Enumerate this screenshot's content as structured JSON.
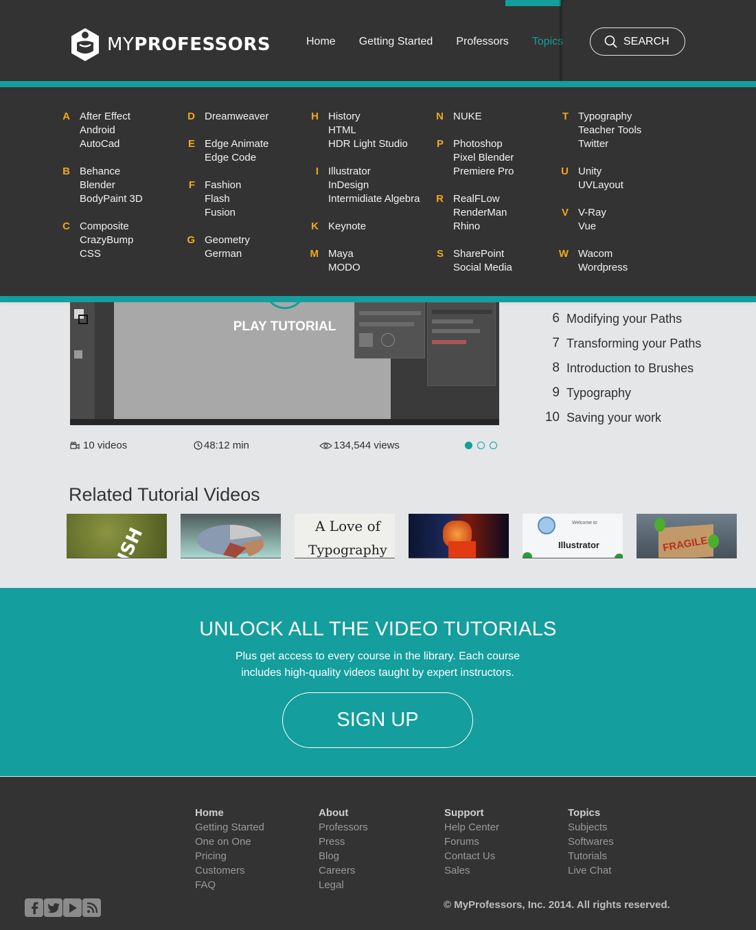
{
  "header": {
    "brand": {
      "prefix": "MY",
      "name": "PROFESSORS"
    },
    "nav": [
      {
        "label": "Home",
        "active": false
      },
      {
        "label": "Getting Started",
        "active": false
      },
      {
        "label": "Professors",
        "active": false
      },
      {
        "label": "Topics",
        "active": true
      }
    ],
    "search_label": "SEARCH"
  },
  "topics_menu": {
    "columns": [
      [
        {
          "letter": "A",
          "items": [
            "After Effect",
            "Android",
            "AutoCad"
          ]
        },
        {
          "letter": "B",
          "items": [
            "Behance",
            "Blender",
            "BodyPaint 3D"
          ]
        },
        {
          "letter": "C",
          "items": [
            "Composite",
            "CrazyBump",
            "CSS"
          ]
        }
      ],
      [
        {
          "letter": "D",
          "items": [
            "Dreamweaver"
          ]
        },
        {
          "letter": "E",
          "items": [
            "Edge Animate",
            "Edge Code"
          ]
        },
        {
          "letter": "F",
          "items": [
            "Fashion",
            "Flash",
            "Fusion"
          ]
        },
        {
          "letter": "G",
          "items": [
            "Geometry",
            "German"
          ]
        }
      ],
      [
        {
          "letter": "H",
          "items": [
            "History",
            "HTML",
            "HDR Light Studio"
          ]
        },
        {
          "letter": "I",
          "items": [
            "Illustrator",
            "InDesign",
            "Intermidiate Algebra"
          ]
        },
        {
          "letter": "K",
          "items": [
            "Keynote"
          ]
        },
        {
          "letter": "M",
          "items": [
            "Maya",
            "MODO"
          ]
        }
      ],
      [
        {
          "letter": "N",
          "items": [
            "NUKE"
          ]
        },
        {
          "letter": "P",
          "items": [
            "Photoshop",
            "Pixel Blender",
            "Premiere Pro"
          ]
        },
        {
          "letter": "R",
          "items": [
            "RealFLow",
            "RenderMan",
            "Rhino"
          ]
        },
        {
          "letter": "S",
          "items": [
            "SharePoint",
            "Social Media"
          ]
        }
      ],
      [
        {
          "letter": "T",
          "items": [
            "Typography",
            "Teacher Tools",
            "Twitter"
          ]
        },
        {
          "letter": "U",
          "items": [
            "Unity",
            "UVLayout"
          ]
        },
        {
          "letter": "V",
          "items": [
            "V-Ray",
            "Vue"
          ]
        },
        {
          "letter": "W",
          "items": [
            "Wacom",
            "Wordpress"
          ]
        }
      ]
    ]
  },
  "video": {
    "play_label": "PLAY TUTORIAL",
    "videos": "10 videos",
    "duration": "48:12 min",
    "views": "134,544 views",
    "slide_index": 1,
    "slide_count": 3
  },
  "lessons": [
    {
      "num": "6",
      "title": "Modifying your Paths"
    },
    {
      "num": "7",
      "title": "Transforming your Paths"
    },
    {
      "num": "8",
      "title": "Introduction to Brushes"
    },
    {
      "num": "9",
      "title": "Typography"
    },
    {
      "num": "10",
      "title": "Saving your work"
    }
  ],
  "related": {
    "title": "Related Tutorial Videos",
    "thumb_texts": {
      "typography_line1": "A Love of",
      "typography_line2": "Typography",
      "illustrator": "Illustrator",
      "welcome": "Welcome to",
      "fragile": "FRAGILE",
      "ish": "ISH"
    }
  },
  "signup": {
    "title": "UNLOCK ALL THE VIDEO TUTORIALS",
    "subtitle_line1": "Plus get access to every course in the library. Each course",
    "subtitle_line2": "includes high-quality videos taught by expert instructors.",
    "button": "SIGN UP"
  },
  "footer": {
    "columns": [
      {
        "head": "Home",
        "links": [
          "Getting Started",
          "One on One",
          "Pricing",
          "Customers",
          "FAQ"
        ]
      },
      {
        "head": "About",
        "links": [
          "Professors",
          "Press",
          "Blog",
          "Careers",
          "Legal"
        ]
      },
      {
        "head": "Support",
        "links": [
          "Help Center",
          "Forums",
          "Contact Us",
          "Sales"
        ]
      },
      {
        "head": "Topics",
        "links": [
          "Subjects",
          "Softwares",
          "Tutorials",
          "Live Chat"
        ]
      }
    ],
    "copyright": "© MyProfessors, Inc. 2014. All rights reserved.",
    "social_icons": [
      "facebook-icon",
      "twitter-icon",
      "youtube-icon",
      "rss-icon"
    ]
  },
  "colors": {
    "teal": "#149e9d",
    "dark": "#333333",
    "accent": "#f2a81d",
    "light": "#e4e6e8"
  }
}
